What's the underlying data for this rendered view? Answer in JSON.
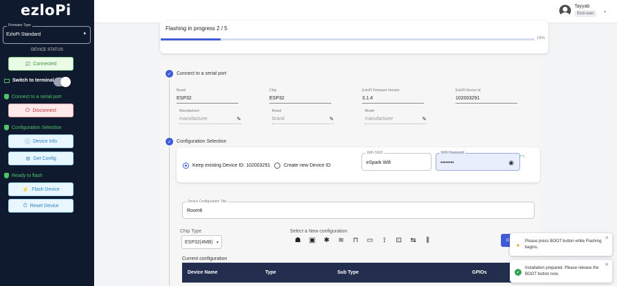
{
  "sidebar": {
    "logo": "ezloPi",
    "firmware_type": {
      "label": "Firmware Type",
      "value": "EzloPi Standard"
    },
    "device_status_title": "DEVICE STATUS",
    "connected_label": "Connected",
    "switch_terminal_label": "Switch to terminal",
    "section_serial": "Connect to a serial port",
    "disconnect_label": "Disconnect",
    "section_config": "Configuration Selection",
    "device_info_label": "Device Info",
    "get_config_label": "Get Config",
    "section_flash": "Ready to flash",
    "flash_device_label": "Flash Device",
    "reset_device_label": "Reset Device"
  },
  "header": {
    "user_name": "Tayyab",
    "user_role": "End-user"
  },
  "progress": {
    "title": "Flashing in progress 2 / 5",
    "percent_text": "16%",
    "fraction": 0.16
  },
  "step_serial": {
    "title": "Connect to a serial port",
    "board": {
      "label": "Board",
      "value": "ESP32"
    },
    "chip": {
      "label": "Chip",
      "value": "ESP32"
    },
    "firmware_version": {
      "label": "EzloPi Firmware Version",
      "value": "3.1.4"
    },
    "device_id": {
      "label": "EzloPi Device Id",
      "value": "102003291"
    },
    "manufacturer": {
      "label": "Manufacturer",
      "value": "manufacturer"
    },
    "brand": {
      "label": "Brand",
      "value": "brand"
    },
    "model": {
      "label": "Model",
      "value": "manufacturer"
    }
  },
  "step_config": {
    "title": "Configuration Selection",
    "keep_existing_label": "Keep existing Device ID: 102003291",
    "create_new_label": "Create new Device ID",
    "wifi_ssid": {
      "label": "WiFi SSID",
      "value": "eSpark Wifi"
    },
    "wifi_password": {
      "label": "WiFi Password",
      "value": "••••••••"
    },
    "device_config_title": {
      "label": "Device Configuration Title",
      "value": "Room6"
    },
    "chip_type_label": "Chip Type",
    "chip_type_value": "ESP32(4MB)",
    "select_new_label": "Select a New configuration",
    "add_button_label": "G",
    "current_config_label": "Current configuration",
    "table_columns": [
      "Device Name",
      "Type",
      "Sub Type",
      "GPIOs"
    ],
    "device_icons": [
      "lightbulb-icon",
      "plug-icon",
      "fan-icon",
      "sensor-icon",
      "motion-icon",
      "display-icon",
      "antenna-icon",
      "switch-icon",
      "relay-icon",
      "pins-icon"
    ]
  },
  "toasts": [
    {
      "type": "warning",
      "text": "Please press BOOT button while Flashing begins."
    },
    {
      "type": "success",
      "text": "Installation prepared. Please release the BOOT button now."
    }
  ],
  "colors": {
    "sidebar_bg": "#101a2e",
    "accent": "#3f5bd8",
    "success": "#4fc36a"
  }
}
